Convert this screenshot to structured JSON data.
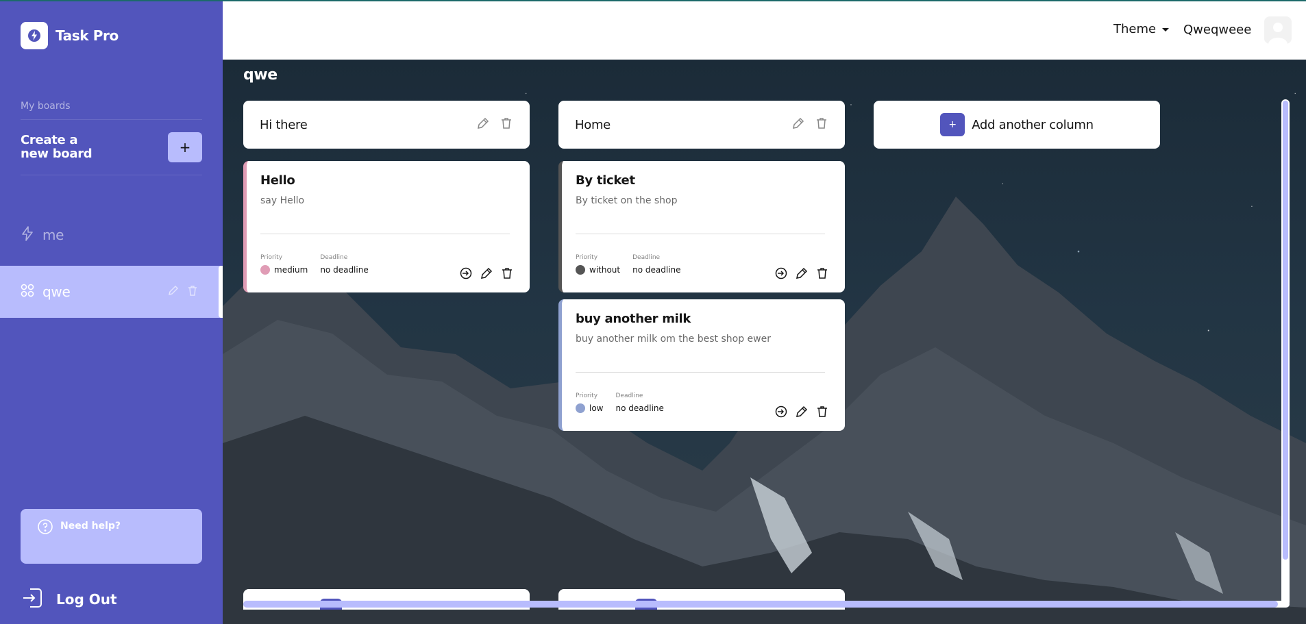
{
  "app": {
    "name": "Task Pro"
  },
  "sidebar": {
    "boards_label": "My boards",
    "create_label": "Create a new board",
    "create_button": "+",
    "boards": [
      {
        "name": "me",
        "icon": "lightning-icon",
        "active": false
      },
      {
        "name": "qwe",
        "icon": "grid-icon",
        "active": true
      }
    ],
    "help_label": "Need help?",
    "logout_label": "Log Out"
  },
  "header": {
    "theme_label": "Theme",
    "username": "Qweqweee"
  },
  "board": {
    "title": "qwe",
    "columns": [
      {
        "title": "Hi there",
        "cards": [
          {
            "title": "Hello",
            "description": "say Hello",
            "priority_label": "Priority",
            "priority": "medium",
            "priority_color": "#e09cb5",
            "deadline_label": "Deadline",
            "deadline": "no deadline"
          }
        ]
      },
      {
        "title": "Home",
        "cards": [
          {
            "title": "By ticket",
            "description": "By ticket on the shop",
            "priority_label": "Priority",
            "priority": "without",
            "priority_color": "#555555",
            "deadline_label": "Deadline",
            "deadline": "no deadline"
          },
          {
            "title": "buy another milk",
            "description": "buy another milk om the best shop ewer",
            "priority_label": "Priority",
            "priority": "low",
            "priority_color": "#8fa1d0",
            "deadline_label": "Deadline",
            "deadline": "no deadline"
          }
        ]
      }
    ],
    "add_column_label": "Add another column",
    "add_column_icon": "+"
  },
  "colors": {
    "accent": "#5255bc",
    "accent_light": "#b8bcfd",
    "medium": "#e09cb5",
    "low": "#8fa1d0",
    "without": "#555555"
  }
}
